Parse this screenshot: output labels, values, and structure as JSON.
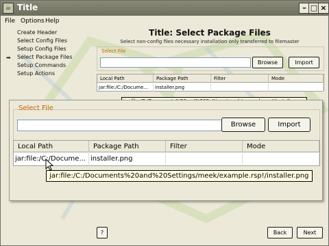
{
  "window": {
    "title": "Title"
  },
  "menu": [
    "File",
    "Options",
    "Help"
  ],
  "sidebar": {
    "current_marker": "➡",
    "steps": [
      {
        "label": "Create Header"
      },
      {
        "label": "Select Config Files"
      },
      {
        "label": "Setup Config Files"
      },
      {
        "label": "Select Package Files"
      },
      {
        "label": "Setup Commands"
      },
      {
        "label": "Setup Actions"
      }
    ],
    "current_index": 3
  },
  "page": {
    "title": "Title: Select Package Files",
    "subtitle": "Select non-config files necessary installation only transferred to filemaster"
  },
  "select_file": {
    "legend": "Select File",
    "input_value": "",
    "browse_label": "Browse",
    "import_label": "Import"
  },
  "table": {
    "columns": [
      "Local Path",
      "Package Path",
      "Filter",
      "Mode"
    ],
    "rows": [
      {
        "local_path_small": "jar:file:/C:/Docume...",
        "local_path": "jar:file:/C:/Docume...",
        "package_path": "installer.png",
        "filter": "",
        "mode": ""
      }
    ]
  },
  "tooltip_small": "jar:file:/C:/Documents%20and%20Settings/meek/example.rsp!/installer.png",
  "tooltip": "jar:file:/C:/Documents%20and%20Settings/meek/example.rsp!/installer.png",
  "footer": {
    "help_label": "?",
    "back_label": "Back",
    "next_label": "Next"
  },
  "colors": {
    "legend": "#c86400",
    "tooltip_bg": "#ffffe1",
    "deco_green": "#c8d9a8"
  }
}
